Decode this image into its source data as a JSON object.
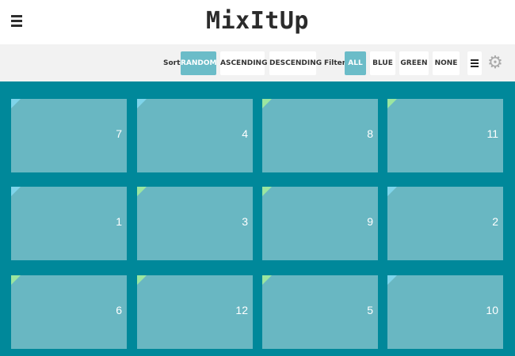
{
  "header": {
    "logo": "MixItUp",
    "menu_icon": "hamburger-icon"
  },
  "controls": {
    "sort_label": "Sort:",
    "sort_options": [
      "RANDOM",
      "ASCENDING",
      "DESCENDING"
    ],
    "sort_active": "RANDOM",
    "filter_label": "Filter:",
    "filter_options": [
      "ALL",
      "BLUE",
      "GREEN",
      "NONE"
    ],
    "filter_active": "ALL",
    "list_icon": "list-icon",
    "settings_icon": "gear-icon"
  },
  "colors": {
    "grid_background": "#00889a",
    "card": "#69b7c2",
    "blue_marker": "#7fd4ea",
    "green_marker": "#9be6a0",
    "active_button": "#6bbcc8"
  },
  "cards": [
    {
      "number": "7",
      "color": "blue"
    },
    {
      "number": "4",
      "color": "blue"
    },
    {
      "number": "8",
      "color": "green"
    },
    {
      "number": "11",
      "color": "green"
    },
    {
      "number": "1",
      "color": "blue"
    },
    {
      "number": "3",
      "color": "green"
    },
    {
      "number": "9",
      "color": "green"
    },
    {
      "number": "2",
      "color": "blue"
    },
    {
      "number": "6",
      "color": "green"
    },
    {
      "number": "12",
      "color": "green"
    },
    {
      "number": "5",
      "color": "green"
    },
    {
      "number": "10",
      "color": "blue"
    }
  ]
}
